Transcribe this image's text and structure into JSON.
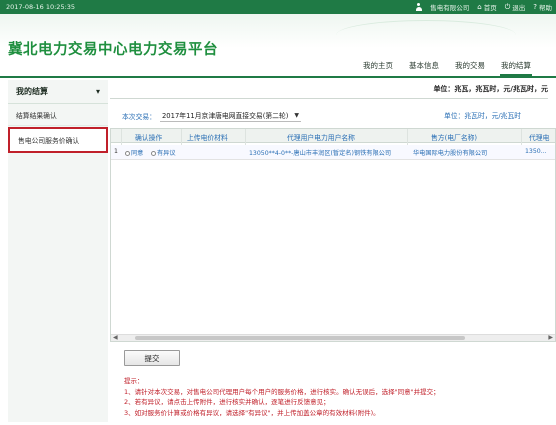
{
  "topbar": {
    "datetime": "2017-08-16  10:25:35",
    "user": "售电有限公司",
    "home": "首页",
    "logout": "退出",
    "help": "帮助"
  },
  "banner": {
    "title": "冀北电力交易中心电力交易平台"
  },
  "mainnav": [
    {
      "label": "我的主页",
      "active": false
    },
    {
      "label": "基本信息",
      "active": false
    },
    {
      "label": "我的交易",
      "active": false
    },
    {
      "label": "我的结算",
      "active": true
    }
  ],
  "sidebar": {
    "heading": "我的结算",
    "items": [
      {
        "label": "结算结果确认",
        "active": false
      },
      {
        "label": "售电公司服务价确认",
        "active": true
      }
    ]
  },
  "content": {
    "unit_line": "单位：兆瓦，兆瓦时，元/兆瓦时，元",
    "filter_label": "本次交易：",
    "filter_value": "2017年11月京津唐电网直接交易(第二轮)",
    "unit_short": "单位：兆瓦时，元/兆瓦时"
  },
  "table": {
    "headers": [
      "确认操作",
      "上传电价材料",
      "代理用户电力用户名称",
      "售方(电厂名称)",
      "代理电"
    ],
    "rows": [
      {
        "index": "1",
        "agree": "同意",
        "disagree": "有异议",
        "user": "13050**4-0**-唐山市丰润区(暂定名)钢铁有限公司",
        "seller": "华电国际电力股份有限公司",
        "extra": "1350..."
      }
    ]
  },
  "submit_label": "提交",
  "tips": [
    "提示：",
    "1、请针对本次交易，对售电公司代理用户每个用户的服务价格，进行核实。确认无误后，选择\"同意\"并提交；",
    "2、若有异议，请点击上传附件，进行核实并确认，逐笔进行反馈意见；",
    "3、如对服务价计算或价格有异议，请选择\"有异议\"，并上传加盖公章的有效材料(附件)。"
  ]
}
